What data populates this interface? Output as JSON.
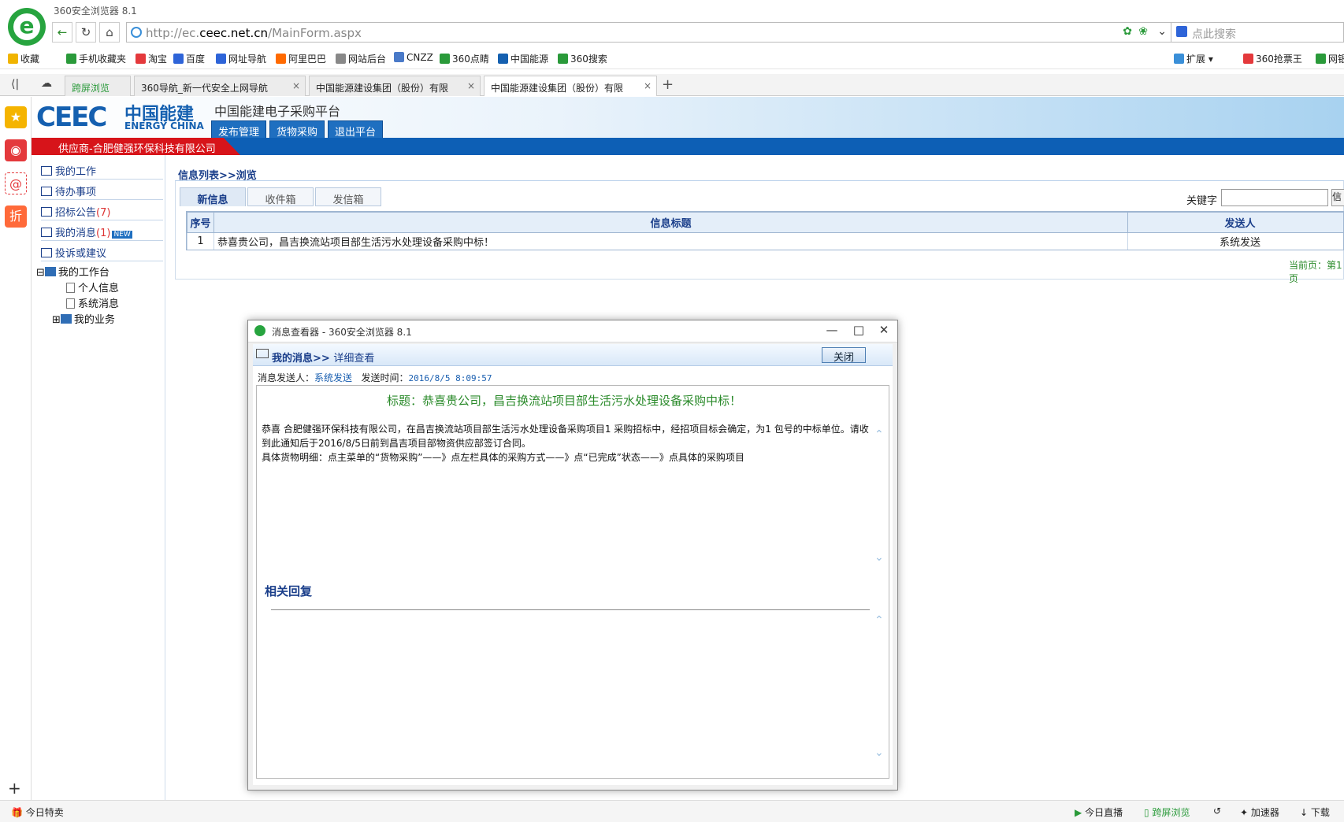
{
  "browser": {
    "title": "360安全浏览器 8.1",
    "url_prefix": "http://ec.",
    "url_domain": "ceec.net.cn",
    "url_path": "/MainForm.aspx",
    "search_placeholder": "点此搜索",
    "bookmarks": [
      {
        "label": "收藏",
        "color": "#f0b400"
      },
      {
        "label": "手机收藏夹",
        "color": "#2a9a3a"
      },
      {
        "label": "淘宝",
        "color": "#e4393c"
      },
      {
        "label": "百度",
        "color": "#2e64d8"
      },
      {
        "label": "网址导航",
        "color": "#2e64d8"
      },
      {
        "label": "阿里巴巴",
        "color": "#ff6a00"
      },
      {
        "label": "网站后台",
        "color": "#888888"
      },
      {
        "label": "CNZZ",
        "color": "#4a7ac8"
      },
      {
        "label": "360点睛",
        "color": "#2a9a3a"
      },
      {
        "label": "中国能源",
        "color": "#1560b0"
      },
      {
        "label": "360搜索",
        "color": "#2a9a3a"
      }
    ],
    "right_bookmarks": [
      "扩展",
      "360抢票王",
      "网银"
    ],
    "tabs": [
      {
        "label": "跨屏浏览"
      },
      {
        "label": "360导航_新一代安全上网导航"
      },
      {
        "label": "中国能源建设集团（股份）有限"
      },
      {
        "label": "中国能源建设集团（股份）有限"
      }
    ],
    "status": {
      "left": "今日特卖",
      "items": [
        "今日直播",
        "跨屏浏览",
        "加速器",
        "下载"
      ]
    }
  },
  "site": {
    "logo_text": "CEEC",
    "logo_cn": "中国能建",
    "logo_en": "ENERGY CHINA",
    "platform_title": "中国能建电子采购平台",
    "menu": [
      "发布管理",
      "货物采购",
      "退出平台"
    ],
    "supplier": "供应商-合肥健强环保科技有限公司"
  },
  "leftmenu": {
    "items": [
      {
        "label": "我的工作",
        "count": ""
      },
      {
        "label": "待办事项",
        "count": ""
      },
      {
        "label": "招标公告",
        "count": "(7)"
      },
      {
        "label": "我的消息",
        "count": "(1)"
      },
      {
        "label": "投诉或建议",
        "count": ""
      }
    ],
    "new_badge": "NEW",
    "tree_root": "我的工作台",
    "tree_children": [
      "个人信息",
      "系统消息"
    ],
    "tree_business": "我的业务"
  },
  "main": {
    "breadcrumb": "信息列表>>浏览",
    "tabs": [
      "新信息",
      "收件箱",
      "发信箱"
    ],
    "keyword_label": "关键字",
    "search_btn": "信",
    "columns": [
      "序号",
      "信息标题",
      "发送人"
    ],
    "rows": [
      {
        "no": "1",
        "title": "恭喜贵公司，昌吉换流站项目部生活污水处理设备采购中标！",
        "sender": "系统发送"
      }
    ],
    "current_page": "当前页：第1页"
  },
  "popup": {
    "title": "消息查看器 - 360安全浏览器 8.1",
    "crumb_a": "我的消息>>",
    "crumb_b": "详细查看",
    "close": "关闭",
    "sender_label": "消息发送人：",
    "sender_value": "系统发送",
    "time_label": "发送时间：",
    "time_value": "2016/8/5 8:09:57",
    "msg_title": "标题：恭喜贵公司，昌吉换流站项目部生活污水处理设备采购中标！",
    "msg_line1": "恭喜 合肥健强环保科技有限公司，在昌吉换流站项目部生活污水处理设备采购项目1 采购招标中，经招项目标会确定，为1 包号的中标单位。请收到此通知后于2016/8/5日前到昌吉项目部物资供应部签订合同。",
    "msg_line2": "具体货物明细：点主菜单的“货物采购”——》点左栏具体的采购方式——》点“已完成”状态——》点具体的采购项目",
    "related": "相关回复"
  }
}
